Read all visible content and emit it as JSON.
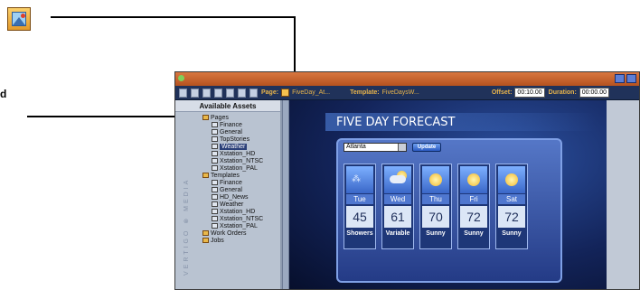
{
  "callout": {
    "cut_label": "d"
  },
  "toolbar": {
    "page_label": "Page:",
    "page_value": "FiveDay_At...",
    "template_label": "Template:",
    "template_value": "FiveDaysW...",
    "offset_label": "Offset:",
    "offset_value": "00:10.00",
    "duration_label": "Duration:",
    "duration_value": "00:00.00"
  },
  "sidebar": {
    "title": "Available Assets",
    "brand": "VERTIGO ⊗ MEDIA",
    "tree": [
      {
        "label": "Pages",
        "type": "folder",
        "indent": 0
      },
      {
        "label": "Finance",
        "type": "item",
        "indent": 1
      },
      {
        "label": "General",
        "type": "item",
        "indent": 1
      },
      {
        "label": "TopStories",
        "type": "item",
        "indent": 1
      },
      {
        "label": "Weather",
        "type": "item",
        "indent": 1,
        "selected": true
      },
      {
        "label": "Xstation_HD",
        "type": "item",
        "indent": 1
      },
      {
        "label": "Xstation_NTSC",
        "type": "item",
        "indent": 1
      },
      {
        "label": "Xstation_PAL",
        "type": "item",
        "indent": 1
      },
      {
        "label": "Templates",
        "type": "folder",
        "indent": 0
      },
      {
        "label": "Finance",
        "type": "item",
        "indent": 1
      },
      {
        "label": "General",
        "type": "item",
        "indent": 1
      },
      {
        "label": "HD_News",
        "type": "item",
        "indent": 1
      },
      {
        "label": "Weather",
        "type": "item",
        "indent": 1
      },
      {
        "label": "Xstation_HD",
        "type": "item",
        "indent": 1
      },
      {
        "label": "Xstation_NTSC",
        "type": "item",
        "indent": 1
      },
      {
        "label": "Xstation_PAL",
        "type": "item",
        "indent": 1
      },
      {
        "label": "Work Orders",
        "type": "folder",
        "indent": 0
      },
      {
        "label": "Jobs",
        "type": "folder",
        "indent": 0
      }
    ]
  },
  "preview": {
    "title": "FIVE DAY FORECAST",
    "city": "Atlanta",
    "update_label": "Update",
    "days": [
      {
        "day": "Tue",
        "temp": "45",
        "cond": "Showers",
        "icon": "rain-icon"
      },
      {
        "day": "Wed",
        "temp": "61",
        "cond": "Variable",
        "icon": "cloud-icon"
      },
      {
        "day": "Thu",
        "temp": "70",
        "cond": "Sunny",
        "icon": "sun-icon"
      },
      {
        "day": "Fri",
        "temp": "72",
        "cond": "Sunny",
        "icon": "sun-icon"
      },
      {
        "day": "Sat",
        "temp": "72",
        "cond": "Sunny",
        "icon": "sun-icon"
      }
    ]
  }
}
